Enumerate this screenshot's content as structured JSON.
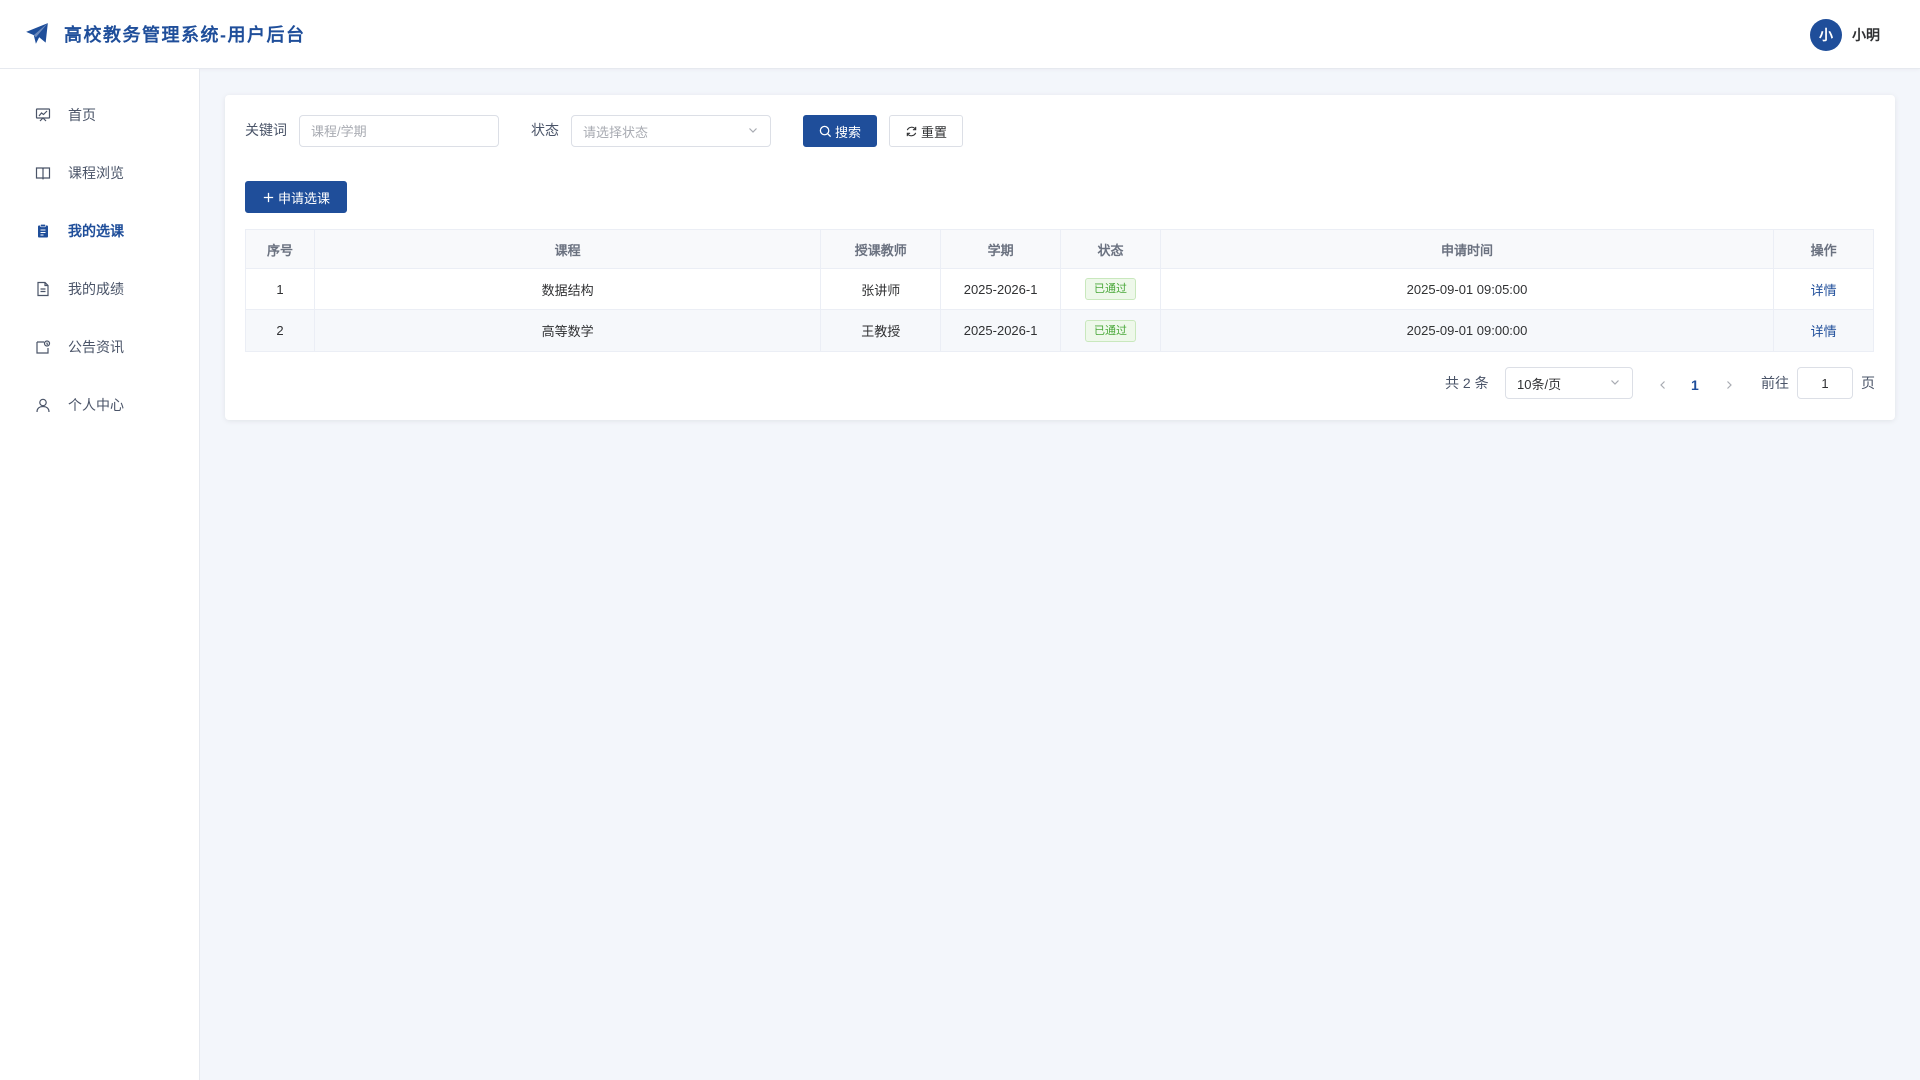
{
  "header": {
    "title": "高校教务管理系统-用户后台",
    "user": {
      "avatar_initial": "小",
      "name": "小明"
    }
  },
  "sidebar": {
    "items": [
      {
        "label": "首页",
        "icon": "dashboard-icon",
        "active": false
      },
      {
        "label": "课程浏览",
        "icon": "book-icon",
        "active": false
      },
      {
        "label": "我的选课",
        "icon": "clipboard-icon",
        "active": true
      },
      {
        "label": "我的成绩",
        "icon": "document-icon",
        "active": false
      },
      {
        "label": "公告资讯",
        "icon": "notice-icon",
        "active": false
      },
      {
        "label": "个人中心",
        "icon": "user-icon",
        "active": false
      }
    ]
  },
  "filters": {
    "keyword_label": "关键词",
    "keyword_placeholder": "课程/学期",
    "keyword_value": "",
    "status_label": "状态",
    "status_placeholder": "请选择状态",
    "search_label": "搜索",
    "reset_label": "重置"
  },
  "actions": {
    "apply_label": "申请选课"
  },
  "table": {
    "headers": [
      "序号",
      "课程",
      "授课教师",
      "学期",
      "状态",
      "申请时间",
      "操作"
    ],
    "rows": [
      {
        "index": "1",
        "course": "数据结构",
        "teacher": "张讲师",
        "term": "2025-2026-1",
        "status": "已通过",
        "time": "2025-09-01 09:05:00",
        "action": "详情"
      },
      {
        "index": "2",
        "course": "高等数学",
        "teacher": "王教授",
        "term": "2025-2026-1",
        "status": "已通过",
        "time": "2025-09-01 09:00:00",
        "action": "详情"
      }
    ]
  },
  "pagination": {
    "total_text": "共 2 条",
    "page_size": "10条/页",
    "current_page": "1",
    "goto_label": "前往",
    "goto_value": "1",
    "page_suffix": "页"
  },
  "colors": {
    "primary": "#1f4e9a",
    "success": "#4aa83a",
    "background": "#f3f6fb"
  }
}
